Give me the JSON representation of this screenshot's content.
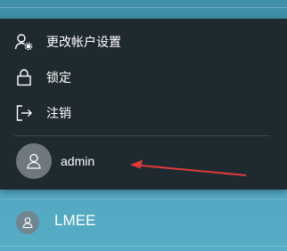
{
  "menu": {
    "items": [
      {
        "label": "更改帐户设置",
        "icon": "user-settings-icon"
      },
      {
        "label": "锁定",
        "icon": "lock-icon"
      },
      {
        "label": "注销",
        "icon": "sign-out-icon"
      }
    ]
  },
  "current_user": {
    "name": "admin",
    "icon": "user-avatar-icon"
  },
  "other_account": {
    "name": "LMEE",
    "icon": "user-avatar-icon"
  },
  "colors": {
    "menu_bg": "#1f2a30",
    "divider": "#3d484e",
    "annotation_arrow": "#e03a3a",
    "desktop_bg": "#4a9bb4"
  }
}
